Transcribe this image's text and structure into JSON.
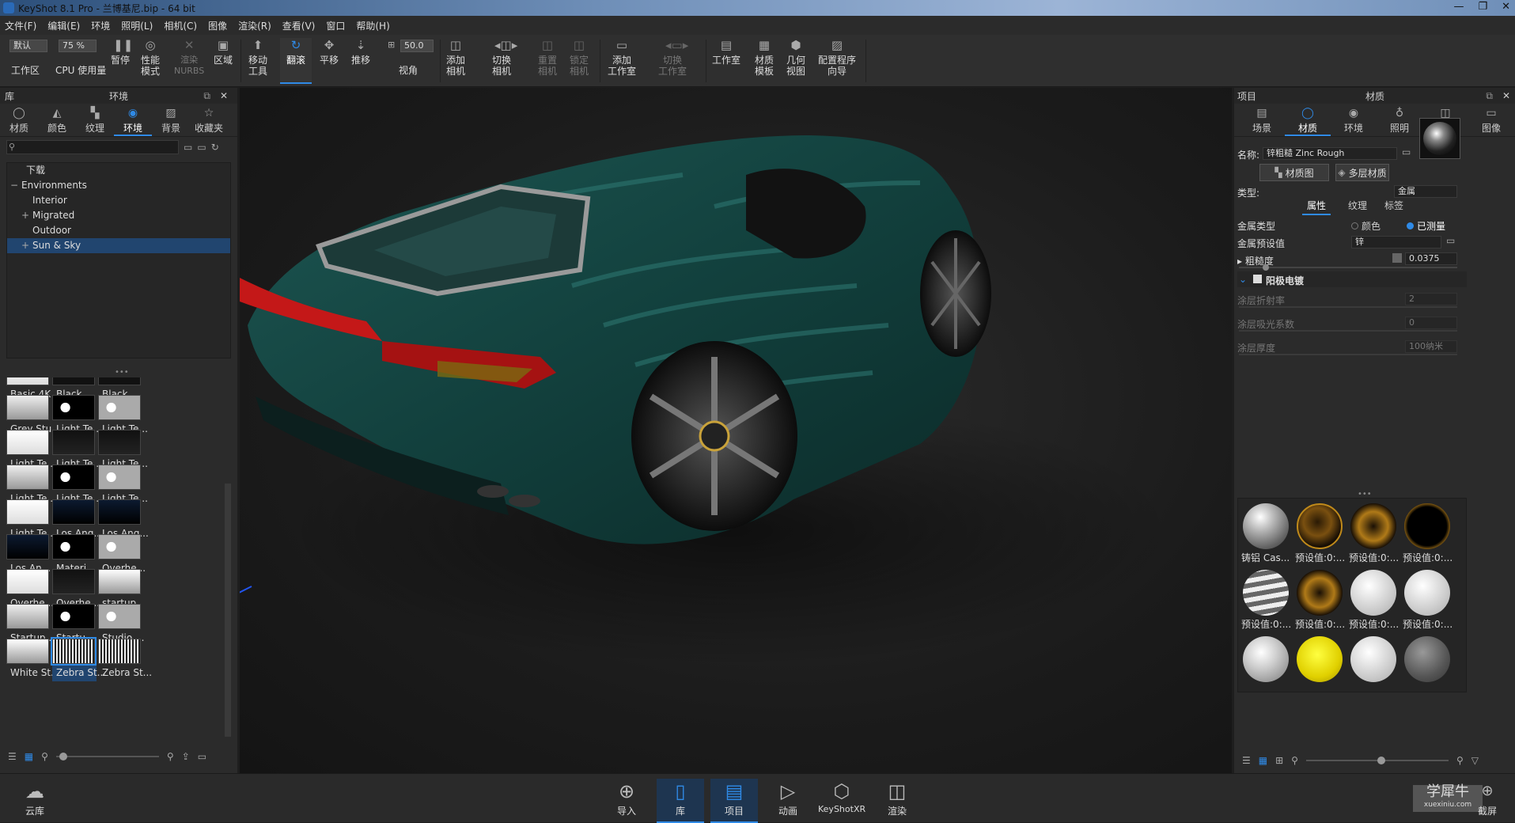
{
  "window": {
    "title": "KeyShot 8.1 Pro - 兰博基尼.bip - 64 bit",
    "controls": [
      "—",
      "❐",
      "✕"
    ]
  },
  "menu": [
    "文件(F)",
    "编辑(E)",
    "环境",
    "照明(L)",
    "相机(C)",
    "图像",
    "渲染(R)",
    "查看(V)",
    "窗口",
    "帮助(H)"
  ],
  "toolbar": {
    "workspace_select": "默认",
    "cpu_select": "75 %",
    "fov_value": "50.0",
    "items": [
      {
        "label": "工作区"
      },
      {
        "label": "CPU 使用量"
      },
      {
        "label": "暂停"
      },
      {
        "label": "性能\n模式"
      },
      {
        "label": "渲染\nNURBS"
      },
      {
        "label": "区域"
      },
      {
        "label": "移动\n工具"
      },
      {
        "label": "翻滚"
      },
      {
        "label": "平移"
      },
      {
        "label": "推移"
      },
      {
        "label": "视角"
      },
      {
        "label": "添加\n相机"
      },
      {
        "label": "切换\n相机"
      },
      {
        "label": "重置\n相机"
      },
      {
        "label": "锁定\n相机"
      },
      {
        "label": "添加\n工作室"
      },
      {
        "label": "切换\n工作室"
      },
      {
        "label": "工作室"
      },
      {
        "label": "材质\n模板"
      },
      {
        "label": "几何\n视图"
      },
      {
        "label": "配置程序\n向导"
      }
    ]
  },
  "library": {
    "header_left": "库",
    "header_title": "环境",
    "tabs": [
      "材质",
      "颜色",
      "纹理",
      "环境",
      "背景",
      "收藏夹"
    ],
    "active_tab": "环境",
    "tree": [
      {
        "label": "下载",
        "indent": 0,
        "toggle": ""
      },
      {
        "label": "Environments",
        "indent": 0,
        "toggle": "−"
      },
      {
        "label": "Interior",
        "indent": 1,
        "toggle": ""
      },
      {
        "label": "Migrated",
        "indent": 1,
        "toggle": "+"
      },
      {
        "label": "Outdoor",
        "indent": 1,
        "toggle": ""
      },
      {
        "label": "Sun & Sky",
        "indent": 1,
        "toggle": "+"
      }
    ],
    "selected_tree": "Sun & Sky",
    "thumbs": [
      "Basic 4K",
      "Black ...",
      "Black ...",
      "Grey Stu...",
      "Light Te...",
      "Light Te...",
      "Light Te...",
      "Light Te...",
      "Light Te...",
      "Light Te...",
      "Light Te...",
      "Light Te...",
      "Light Te...",
      "Los Ang...",
      "Los Ang...",
      "Los An...",
      "Materi...",
      "Overhe...",
      "Overhe...",
      "Overhe...",
      "startup",
      "Startup...",
      "Startu...",
      "Studio ...",
      "White St...",
      "Zebra St...",
      "Zebra St..."
    ],
    "selected_thumb": "Zebra St..."
  },
  "project": {
    "header_left": "项目",
    "header_title": "材质",
    "tabs": [
      "场景",
      "材质",
      "环境",
      "照明",
      "相机",
      "图像"
    ],
    "active_tab": "材质",
    "name_label": "名称:",
    "name_value": "锌粗糙 Zinc Rough",
    "btn_material_graph": "材质图",
    "btn_multi_material": "多层材质",
    "type_label": "类型:",
    "type_value": "金属",
    "subtabs": [
      "属性",
      "纹理",
      "标签"
    ],
    "metal_type_label": "金属类型",
    "radio_color": "颜色",
    "radio_measured": "已测量",
    "metal_preset_label": "金属预设值",
    "metal_preset_value": "锌",
    "roughness_label": "粗糙度",
    "roughness_value": "0.0375",
    "anodize_label": "阳极电镀",
    "coat_ior_label": "涂层折射率",
    "coat_ior_value": "2",
    "coat_absorb_label": "涂层吸光系数",
    "coat_absorb_value": "0",
    "coat_thick_label": "涂层厚度",
    "coat_thick_value": "100纳米",
    "balls": [
      "铸铝 Cas...",
      "预设值:0:...",
      "预设值:0:...",
      "预设值:0:...",
      "预设值:0:...",
      "预设值:0:...",
      "预设值:0:...",
      "预设值:0:..."
    ]
  },
  "bottom": {
    "cloud": "云库",
    "items": [
      "导入",
      "库",
      "项目",
      "动画",
      "KeyShotXR",
      "渲染"
    ],
    "active": [
      "库",
      "项目"
    ],
    "screenshot": "截屏",
    "watermark": "学犀牛",
    "watermark_sub": "xuexiniu.com"
  },
  "colors": {
    "accent": "#2f8ae6",
    "car_body": "#12403d",
    "taillight": "#c41818"
  }
}
